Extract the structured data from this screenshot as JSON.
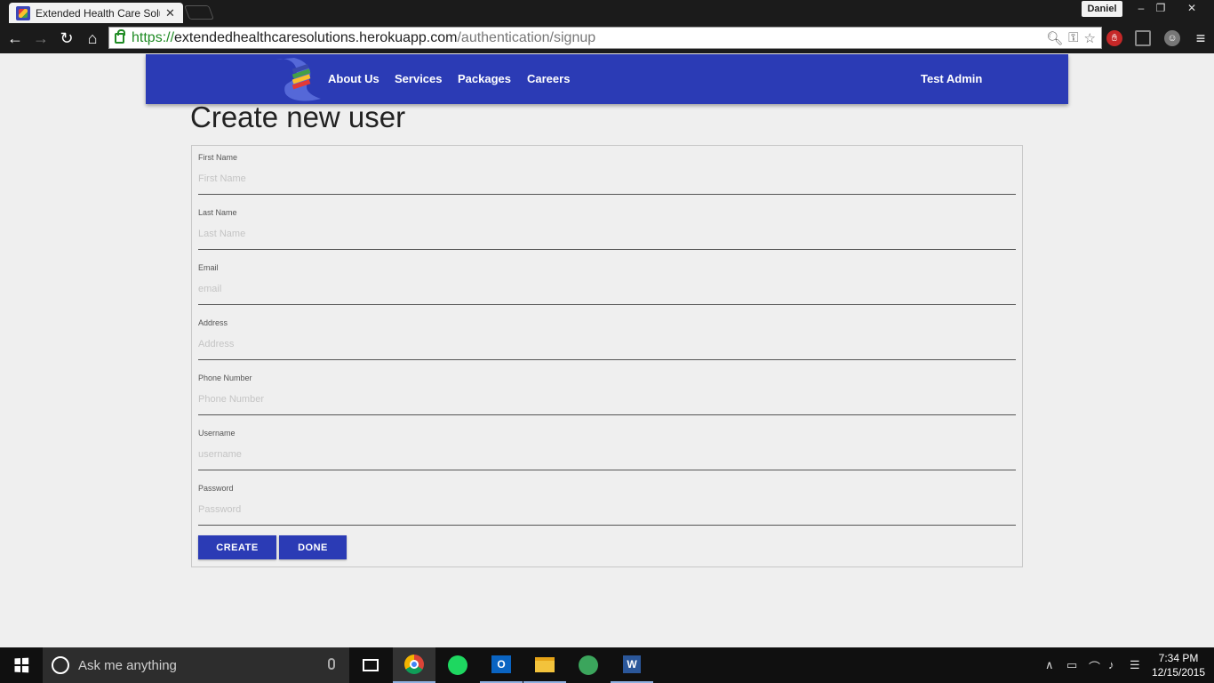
{
  "browser": {
    "tab_title": "Extended Health Care Solu",
    "profile_name": "Daniel",
    "url_scheme": "https://",
    "url_host": "extendedhealthcaresolutions.herokuapp.com",
    "url_path": "/authentication/signup"
  },
  "site": {
    "nav": [
      "About Us",
      "Services",
      "Packages",
      "Careers"
    ],
    "user_name": "Test Admin",
    "brand_color": "#2b3bb5"
  },
  "page": {
    "title": "Create new user",
    "fields": [
      {
        "label": "First Name",
        "placeholder": "First Name"
      },
      {
        "label": "Last Name",
        "placeholder": "Last Name"
      },
      {
        "label": "Email",
        "placeholder": "email"
      },
      {
        "label": "Address",
        "placeholder": "Address"
      },
      {
        "label": "Phone Number",
        "placeholder": "Phone Number"
      },
      {
        "label": "Username",
        "placeholder": "username"
      },
      {
        "label": "Password",
        "placeholder": "Password"
      }
    ],
    "create_label": "CREATE",
    "done_label": "DONE"
  },
  "taskbar": {
    "search_placeholder": "Ask me anything",
    "time": "7:34 PM",
    "date": "12/15/2015",
    "apps": [
      "task-view",
      "chrome",
      "spotify",
      "outlook",
      "file-explorer",
      "atom",
      "word"
    ]
  }
}
